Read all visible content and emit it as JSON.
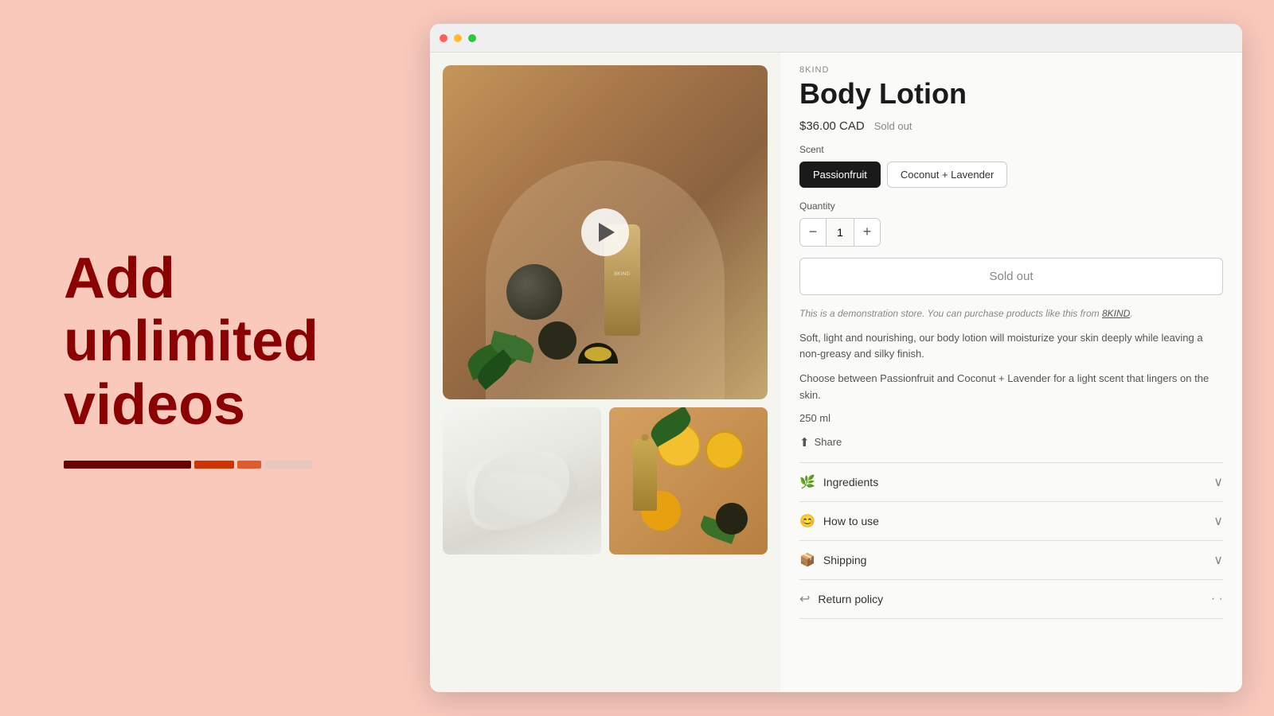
{
  "left": {
    "title_line1": "Add",
    "title_line2": "unlimited",
    "title_line3": "videos"
  },
  "browser": {
    "product": {
      "brand": "8KIND",
      "title": "Body Lotion",
      "price": "$36.00 CAD",
      "sold_out_label": "Sold out",
      "scent_label": "Scent",
      "scent_options": [
        {
          "label": "Passionfruit",
          "active": true
        },
        {
          "label": "Coconut + Lavender",
          "active": false
        }
      ],
      "quantity_label": "Quantity",
      "quantity_value": "1",
      "sold_out_button": "Sold out",
      "demo_text": "This is a demonstration store. You can purchase products like this from ",
      "demo_link": "8KIND",
      "demo_period": ".",
      "description1": "Soft, light and nourishing, our body lotion will moisturize your skin deeply while leaving a non-greasy and silky finish.",
      "description2": "Choose between Passionfruit and Coconut + Lavender for a light scent that lingers on the skin.",
      "volume": "250 ml",
      "share_label": "Share",
      "accordion_items": [
        {
          "icon": "leaf-icon",
          "label": "Ingredients"
        },
        {
          "icon": "face-icon",
          "label": "How to use"
        },
        {
          "icon": "truck-icon",
          "label": "Shipping"
        },
        {
          "icon": "return-icon",
          "label": "Return policy"
        }
      ]
    }
  }
}
